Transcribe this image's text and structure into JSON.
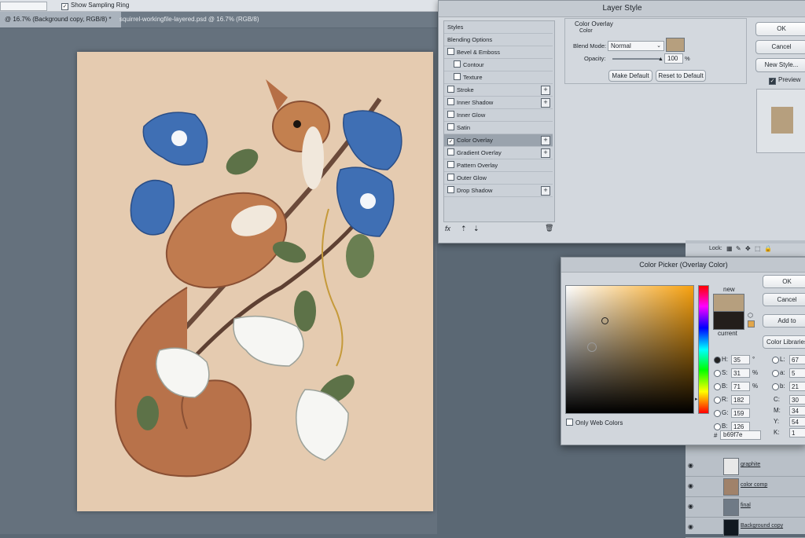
{
  "options_bar": {
    "sampling_ring_checkbox": "✓",
    "sampling_ring_label": "Show Sampling Ring"
  },
  "tabs": [
    {
      "label": "@ 16.7% (Background copy, RGB/8) *"
    },
    {
      "label": "squirrel-workingfile-layered.psd @ 16.7% (RGB/8)"
    }
  ],
  "layer_style": {
    "title": "Layer Style",
    "styles_header": "Styles",
    "items": [
      {
        "label": "Blending Options",
        "checkbox": false,
        "has_plus": false,
        "checked": false
      },
      {
        "label": "Bevel & Emboss",
        "checkbox": true,
        "has_plus": false,
        "checked": false
      },
      {
        "label": "Contour",
        "checkbox": true,
        "has_plus": false,
        "checked": false
      },
      {
        "label": "Texture",
        "checkbox": true,
        "has_plus": false,
        "checked": false
      },
      {
        "label": "Stroke",
        "checkbox": true,
        "has_plus": true,
        "checked": false
      },
      {
        "label": "Inner Shadow",
        "checkbox": true,
        "has_plus": true,
        "checked": false
      },
      {
        "label": "Inner Glow",
        "checkbox": true,
        "has_plus": false,
        "checked": false
      },
      {
        "label": "Satin",
        "checkbox": true,
        "has_plus": false,
        "checked": false
      },
      {
        "label": "Color Overlay",
        "checkbox": true,
        "has_plus": true,
        "checked": true
      },
      {
        "label": "Gradient Overlay",
        "checkbox": true,
        "has_plus": true,
        "checked": false
      },
      {
        "label": "Pattern Overlay",
        "checkbox": true,
        "has_plus": false,
        "checked": false
      },
      {
        "label": "Outer Glow",
        "checkbox": true,
        "has_plus": false,
        "checked": false
      },
      {
        "label": "Drop Shadow",
        "checkbox": true,
        "has_plus": true,
        "checked": false
      }
    ],
    "footer_fx": "fx",
    "section_title": "Color Overlay",
    "section_sub": "Color",
    "blend_mode_label": "Blend Mode:",
    "blend_mode_value": "Normal",
    "opacity_label": "Opacity:",
    "opacity_value": "100",
    "opacity_unit": "%",
    "opacity_fraction": 1.0,
    "make_default": "Make Default",
    "reset_default": "Reset to Default",
    "ok": "OK",
    "cancel": "Cancel",
    "new_style": "New Style...",
    "preview_check": "✓",
    "preview_label": "Preview",
    "overlay_color": "#b69f7e"
  },
  "color_picker": {
    "title": "Color Picker (Overlay Color)",
    "new_label": "new",
    "current_label": "current",
    "new_color": "#b69f7e",
    "current_color": "#231e1b",
    "ok": "OK",
    "cancel": "Cancel",
    "add_swatches": "Add to Swatches",
    "color_libraries": "Color Libraries",
    "only_web_colors": "Only Web Colors",
    "hsb": [
      {
        "label": "H:",
        "value": "35",
        "unit": "°"
      },
      {
        "label": "S:",
        "value": "31",
        "unit": "%"
      },
      {
        "label": "B:",
        "value": "71",
        "unit": "%"
      }
    ],
    "rgb": [
      {
        "label": "R:",
        "value": "182"
      },
      {
        "label": "G:",
        "value": "159"
      },
      {
        "label": "B:",
        "value": "126"
      }
    ],
    "lab": [
      {
        "label": "L:",
        "value": "67"
      },
      {
        "label": "a:",
        "value": "5"
      },
      {
        "label": "b:",
        "value": "21"
      }
    ],
    "cmyk": [
      {
        "label": "C:",
        "value": "30"
      },
      {
        "label": "M:",
        "value": "34"
      },
      {
        "label": "Y:",
        "value": "54"
      },
      {
        "label": "K:",
        "value": "1"
      }
    ],
    "hex_label": "#",
    "hex_value": "b69f7e"
  },
  "layers_panel": {
    "lock_label": "Lock:",
    "layers": [
      {
        "name": "graphite",
        "visible": true,
        "thumb": "#e8e8e8"
      },
      {
        "name": "color comp",
        "visible": true,
        "thumb": "#a0826a"
      },
      {
        "name": "final",
        "visible": true,
        "thumb": "#6f7a86"
      },
      {
        "name": "Background copy",
        "visible": true,
        "thumb": "#111820"
      }
    ]
  },
  "colors": {
    "artboard": "#e5cbb0",
    "flower_blue": "#3f6fb4",
    "squirrel": "#c07b4f"
  }
}
